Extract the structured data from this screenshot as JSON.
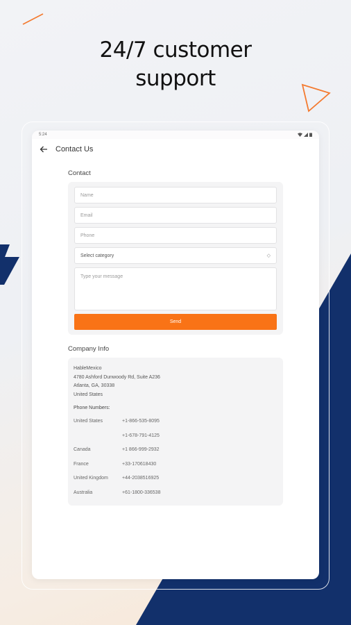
{
  "headline": {
    "line1": "24/7 customer",
    "line2": "support"
  },
  "colors": {
    "accent": "#f97316",
    "navy": "#12306b",
    "card_bg": "#f4f4f5"
  },
  "status_bar": {
    "time": "5:24"
  },
  "app_bar": {
    "back_icon": "arrow-left-icon",
    "title": "Contact Us"
  },
  "contact_form": {
    "section_title": "Contact",
    "name_placeholder": "Name",
    "email_placeholder": "Email",
    "phone_placeholder": "Phone",
    "category_value": "Select category",
    "category_arrow": "◇",
    "message_placeholder": "Type your message",
    "send_label": "Send"
  },
  "company_info": {
    "section_title": "Company Info",
    "address": [
      "HableMexico",
      "4780 Ashford Dunwoody Rd, Suite A236",
      "Atlanta, GA, 30338",
      "United States"
    ],
    "phones_title": "Phone Numbers:",
    "phones": [
      {
        "country": "United States",
        "number": "+1-866-535-8095"
      },
      {
        "country": "",
        "number": "+1-678-791-4125"
      },
      {
        "country": "Canada",
        "number": "+1 866-999-2932"
      },
      {
        "country": "France",
        "number": "+33-170618430"
      },
      {
        "country": "United Kingdom",
        "number": "+44-2038516925"
      },
      {
        "country": "Australia",
        "number": "+61-1800-336538"
      }
    ]
  }
}
